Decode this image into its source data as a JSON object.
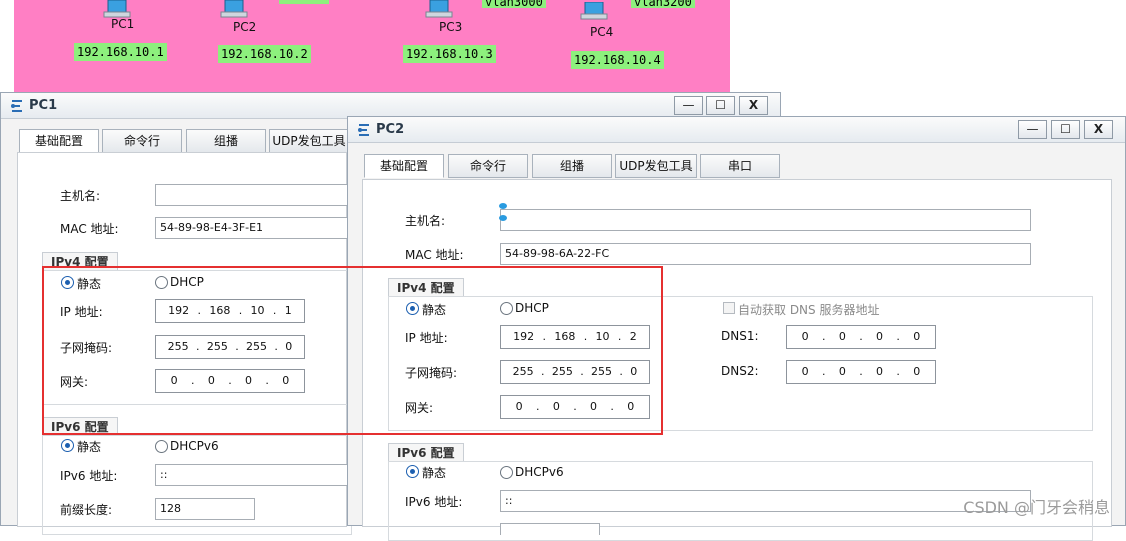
{
  "topology": {
    "nodes": [
      {
        "name": "PC1",
        "ip": "192.168.10.1"
      },
      {
        "name": "PC2",
        "ip": "192.168.10.2"
      },
      {
        "name": "PC3",
        "ip": "192.168.10.3",
        "vlan": "vlan3000"
      },
      {
        "name": "PC4",
        "ip": "192.168.10.4",
        "vlan": "vlan3200"
      }
    ]
  },
  "pc1": {
    "title": "PC1",
    "tabs": [
      "基础配置",
      "命令行",
      "组播",
      "UDP发包工具"
    ],
    "hostname_label": "主机名:",
    "hostname_value": "",
    "mac_label": "MAC 地址:",
    "mac_value": "54-89-98-E4-3F-E1",
    "ipv4_group": "IPv4 配置",
    "static_label": "静态",
    "dhcp_label": "DHCP",
    "ip_label": "IP 地址:",
    "ip": [
      "192",
      "168",
      "10",
      "1"
    ],
    "mask_label": "子网掩码:",
    "mask": [
      "255",
      "255",
      "255",
      "0"
    ],
    "gateway_label": "网关:",
    "gateway": [
      "0",
      "0",
      "0",
      "0"
    ],
    "ipv6_group": "IPv6 配置",
    "static6_label": "静态",
    "dhcpv6_label": "DHCPv6",
    "ipv6_label": "IPv6 地址:",
    "ipv6_value": "::",
    "prefix_label": "前缀长度:",
    "prefix_value": "128"
  },
  "pc2": {
    "title": "PC2",
    "tabs": [
      "基础配置",
      "命令行",
      "组播",
      "UDP发包工具",
      "串口"
    ],
    "hostname_label": "主机名:",
    "hostname_value": "",
    "mac_label": "MAC 地址:",
    "mac_value": "54-89-98-6A-22-FC",
    "ipv4_group": "IPv4 配置",
    "static_label": "静态",
    "dhcp_label": "DHCP",
    "auto_dns_label": "自动获取 DNS 服务器地址",
    "ip_label": "IP 地址:",
    "ip": [
      "192",
      "168",
      "10",
      "2"
    ],
    "mask_label": "子网掩码:",
    "mask": [
      "255",
      "255",
      "255",
      "0"
    ],
    "gateway_label": "网关:",
    "gateway": [
      "0",
      "0",
      "0",
      "0"
    ],
    "dns1_label": "DNS1:",
    "dns1": [
      "0",
      "0",
      "0",
      "0"
    ],
    "dns2_label": "DNS2:",
    "dns2": [
      "0",
      "0",
      "0",
      "0"
    ],
    "ipv6_group": "IPv6 配置",
    "static6_label": "静态",
    "dhcpv6_label": "DHCPv6",
    "ipv6_label": "IPv6 地址:",
    "ipv6_value": "::"
  },
  "window_buttons": {
    "minimize": "—",
    "maximize": "☐",
    "close": "X"
  },
  "watermark": "CSDN @门牙会稍息",
  "colors": {
    "canvas": "#ff7fc4",
    "ip_tag": "#8df07d",
    "highlight": "#e53030",
    "radio": "#1c5fb0"
  }
}
